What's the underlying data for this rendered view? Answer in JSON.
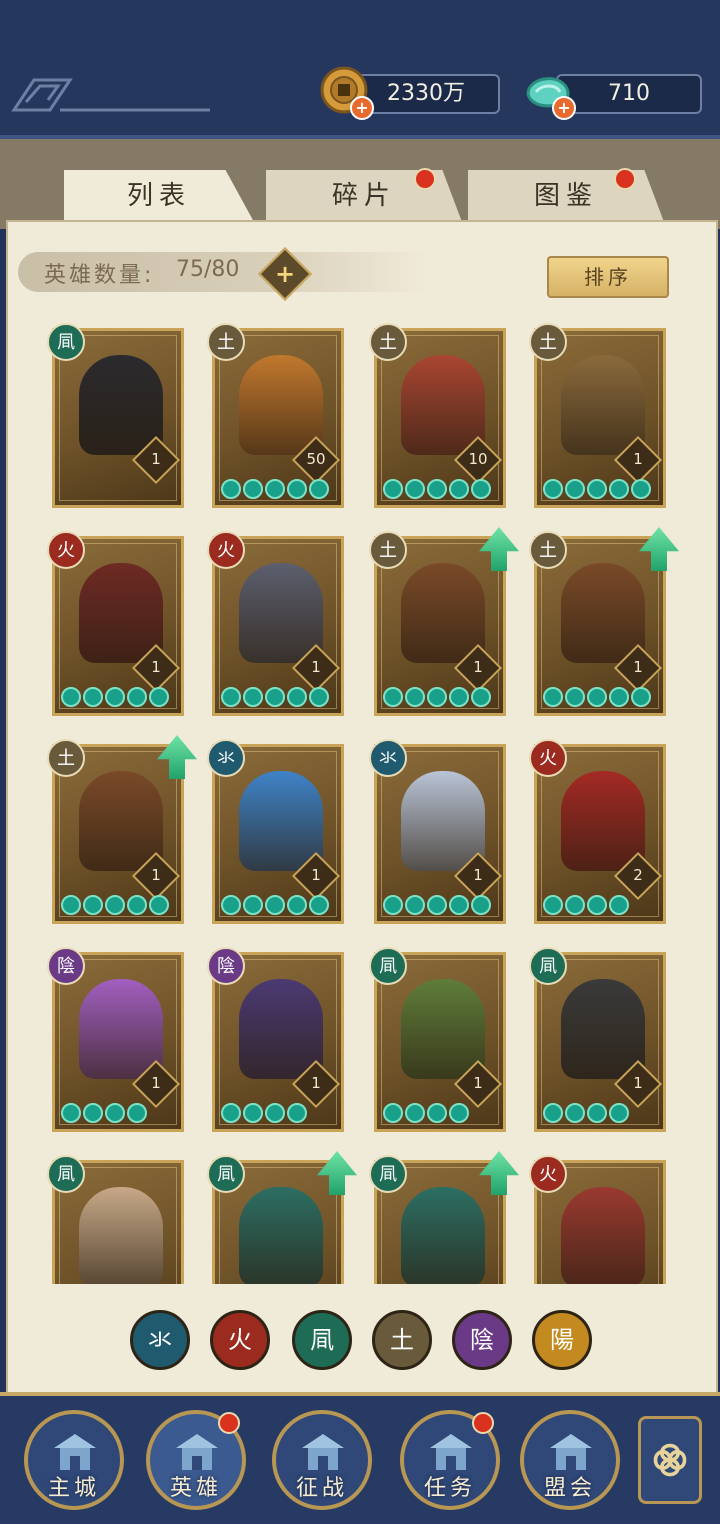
{
  "resources": {
    "coins": "2330万",
    "jade": "710"
  },
  "tabs": [
    {
      "label": "列表",
      "active": true,
      "has_dot": false
    },
    {
      "label": "碎片",
      "active": false,
      "has_dot": true
    },
    {
      "label": "图鉴",
      "active": false,
      "has_dot": true
    }
  ],
  "hero_count": {
    "label": "英雄数量:",
    "value": "75/80"
  },
  "sort_label": "排序",
  "element_colors": {
    "wind": "#1e6b56",
    "fire": "#9b2b1f",
    "earth": "#6a5a3c",
    "water": "#1f5a6e",
    "yin": "#6b3a86",
    "yang": "#c38a20"
  },
  "heroes": [
    {
      "element": "wind",
      "glyph": "凬",
      "level": "1",
      "stars": 0,
      "upgrade": false,
      "tone": "#2b2a2e"
    },
    {
      "element": "earth",
      "glyph": "土",
      "level": "50",
      "stars": 5,
      "upgrade": false,
      "tone": "#c2782e"
    },
    {
      "element": "earth",
      "glyph": "土",
      "level": "10",
      "stars": 5,
      "upgrade": false,
      "tone": "#a94632"
    },
    {
      "element": "earth",
      "glyph": "土",
      "level": "1",
      "stars": 5,
      "upgrade": false,
      "tone": "#8a6a3c"
    },
    {
      "element": "fire",
      "glyph": "火",
      "level": "1",
      "stars": 5,
      "upgrade": false,
      "tone": "#6e2a24"
    },
    {
      "element": "fire",
      "glyph": "火",
      "level": "1",
      "stars": 5,
      "upgrade": false,
      "tone": "#5c5f6e"
    },
    {
      "element": "earth",
      "glyph": "土",
      "level": "1",
      "stars": 5,
      "upgrade": true,
      "tone": "#7a4a28"
    },
    {
      "element": "earth",
      "glyph": "土",
      "level": "1",
      "stars": 5,
      "upgrade": true,
      "tone": "#7a4a28"
    },
    {
      "element": "earth",
      "glyph": "土",
      "level": "1",
      "stars": 5,
      "upgrade": true,
      "tone": "#7a4a28"
    },
    {
      "element": "water",
      "glyph": "氺",
      "level": "1",
      "stars": 5,
      "upgrade": false,
      "tone": "#3f83c8"
    },
    {
      "element": "water",
      "glyph": "氺",
      "level": "1",
      "stars": 5,
      "upgrade": false,
      "tone": "#b9c4d6"
    },
    {
      "element": "fire",
      "glyph": "火",
      "level": "2",
      "stars": 4,
      "upgrade": false,
      "tone": "#a42a24"
    },
    {
      "element": "yin",
      "glyph": "陰",
      "level": "1",
      "stars": 4,
      "upgrade": false,
      "tone": "#a25fc0"
    },
    {
      "element": "yin",
      "glyph": "陰",
      "level": "1",
      "stars": 4,
      "upgrade": false,
      "tone": "#4b3a73"
    },
    {
      "element": "wind",
      "glyph": "凬",
      "level": "1",
      "stars": 4,
      "upgrade": false,
      "tone": "#5f7d3a"
    },
    {
      "element": "wind",
      "glyph": "凬",
      "level": "1",
      "stars": 4,
      "upgrade": false,
      "tone": "#3a3a3a"
    },
    {
      "element": "wind",
      "glyph": "凬",
      "level": "",
      "stars": 0,
      "upgrade": false,
      "tone": "#c7a988"
    },
    {
      "element": "wind",
      "glyph": "凬",
      "level": "",
      "stars": 0,
      "upgrade": true,
      "tone": "#2c6e63"
    },
    {
      "element": "wind",
      "glyph": "凬",
      "level": "",
      "stars": 0,
      "upgrade": true,
      "tone": "#2c6e63"
    },
    {
      "element": "fire",
      "glyph": "火",
      "level": "",
      "stars": 0,
      "upgrade": false,
      "tone": "#9a3a30"
    }
  ],
  "filters": [
    {
      "element": "water",
      "glyph": "氺"
    },
    {
      "element": "fire",
      "glyph": "火"
    },
    {
      "element": "wind",
      "glyph": "凬"
    },
    {
      "element": "earth",
      "glyph": "土"
    },
    {
      "element": "yin",
      "glyph": "陰"
    },
    {
      "element": "yang",
      "glyph": "陽"
    }
  ],
  "nav": [
    {
      "label": "主城",
      "icon": "city-gate-icon",
      "has_dot": false
    },
    {
      "label": "英雄",
      "icon": "hero-icon",
      "has_dot": true
    },
    {
      "label": "征战",
      "icon": "battle-icon",
      "has_dot": false
    },
    {
      "label": "任务",
      "icon": "task-scroll-icon",
      "has_dot": true
    },
    {
      "label": "盟会",
      "icon": "alliance-pavilion-icon",
      "has_dot": false
    }
  ]
}
